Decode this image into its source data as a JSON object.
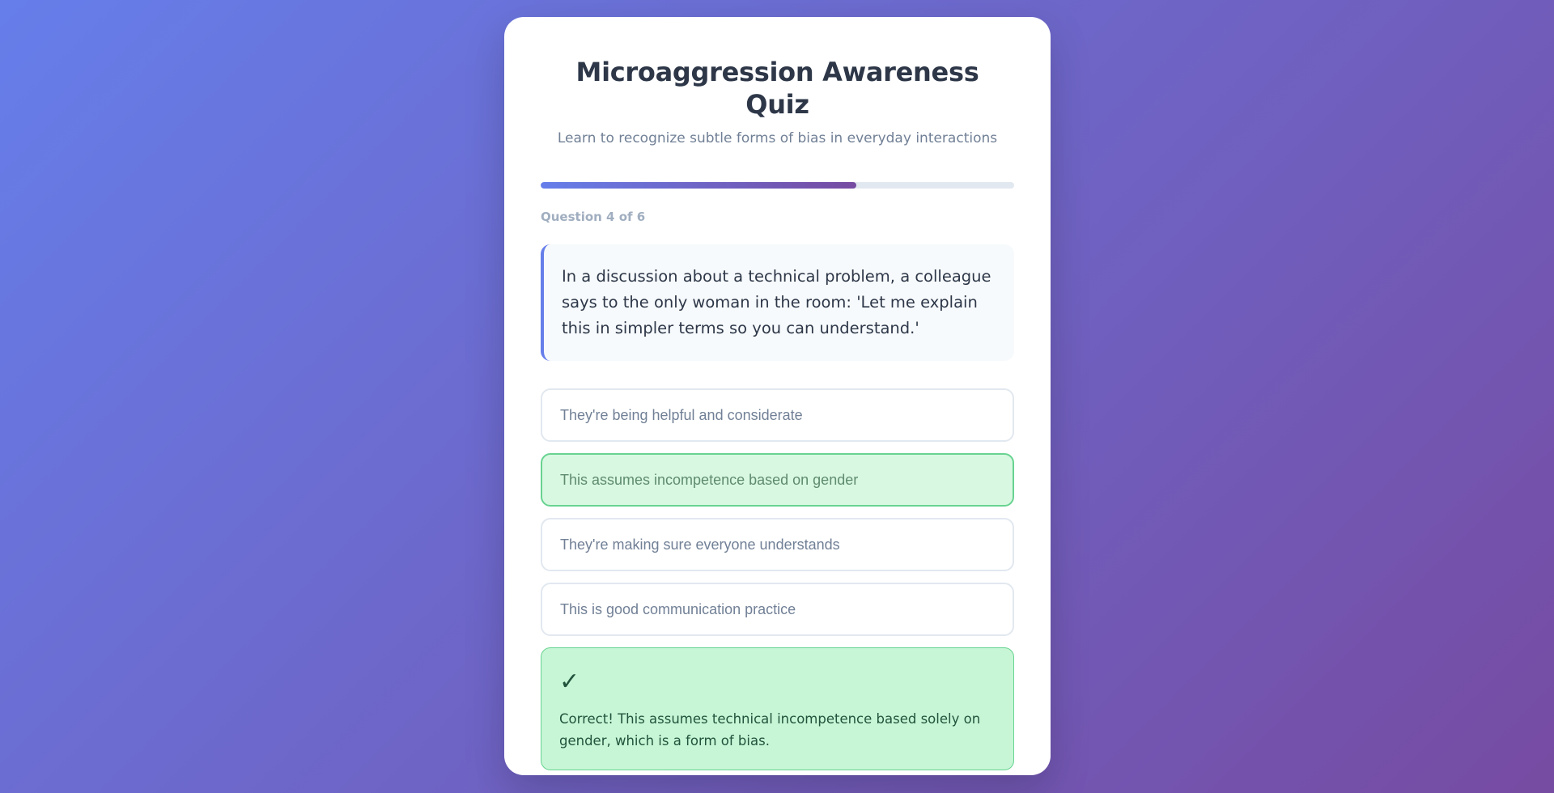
{
  "quiz": {
    "title": "Microaggression Awareness Quiz",
    "subtitle": "Learn to recognize subtle forms of bias in everyday interactions"
  },
  "progress": {
    "fraction": 0.6667,
    "label": "Question 4 of 6"
  },
  "question": {
    "text": "In a discussion about a technical problem, a colleague says to the only woman in the room: 'Let me explain this in simpler terms so you can understand.'"
  },
  "options": [
    {
      "label": "They're being helpful and considerate",
      "state": "default"
    },
    {
      "label": "This assumes incompetence based on gender",
      "state": "correct"
    },
    {
      "label": "They're making sure everyone understands",
      "state": "default"
    },
    {
      "label": "This is good communication practice",
      "state": "default"
    }
  ],
  "feedback": {
    "icon": "✓",
    "text": "Correct! This assumes technical incompetence based solely on gender, which is a form of bias."
  },
  "colors": {
    "gradient_start": "#667eea",
    "gradient_end": "#764ba2",
    "correct_bg": "#c6f6d5",
    "correct_border": "#68d391"
  }
}
